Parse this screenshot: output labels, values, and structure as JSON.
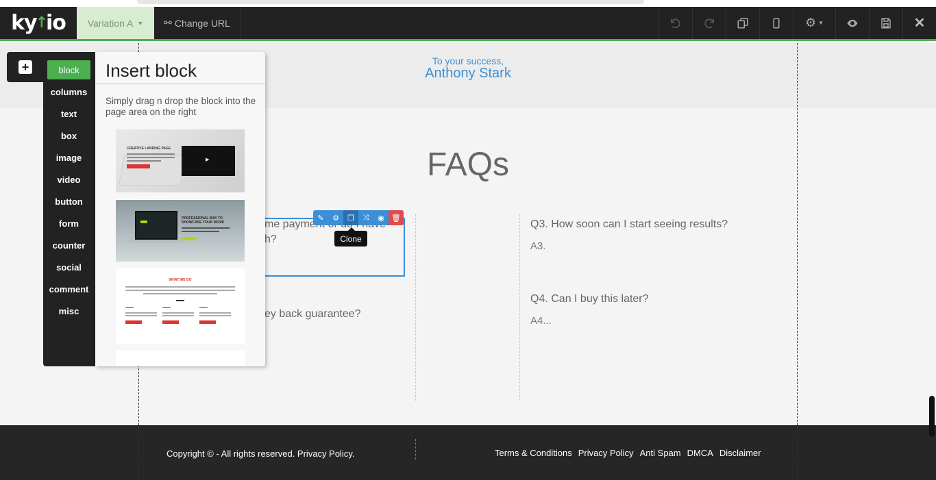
{
  "toolbar": {
    "logo_text": "kyvio",
    "variation_label": "Variation A",
    "change_url_label": "Change URL",
    "icons": [
      "undo-icon",
      "redo-icon",
      "duplicate-icon",
      "mobile-icon",
      "settings-icon",
      "preview-icon",
      "save-icon",
      "close-icon"
    ],
    "accent_color": "#4caf50"
  },
  "signature": {
    "greeting": "To your success,",
    "name": "Anthony Stark"
  },
  "faq": {
    "title": "FAQs",
    "q1_partial_line1": "me payment or do I have",
    "q1_partial_line2": "h?",
    "q2_partial": "ey back guarantee?",
    "q3": "Q3. How soon can I start seeing results?",
    "a3": "A3.",
    "q4": "Q4. Can I buy this later?",
    "a4": "A4..."
  },
  "selection": {
    "tooltip": "Clone",
    "tools": [
      "edit-icon",
      "settings-icon",
      "clone-icon",
      "shuffle-icon",
      "visibility-icon",
      "delete-icon"
    ]
  },
  "insert_panel": {
    "title": "Insert block",
    "description": "Simply drag n drop the block into the page area on the right",
    "menu": [
      "block",
      "columns",
      "text",
      "box",
      "image",
      "video",
      "button",
      "form",
      "counter",
      "social",
      "comment",
      "misc"
    ],
    "active_item": "block",
    "thumbs": {
      "t1_heading": "CREATIVE LANDING PAGE",
      "t2_heading": "PROFESSIONAL WAY TO SHOWCASE YOUR WORK",
      "t3_heading": "WHAT WE DO"
    }
  },
  "footer": {
    "copyright": "Copyright © - All rights reserved. Privacy Policy.",
    "links": [
      "Terms & Conditions",
      "Privacy Policy",
      "Anti Spam",
      "DMCA",
      "Disclaimer"
    ]
  }
}
